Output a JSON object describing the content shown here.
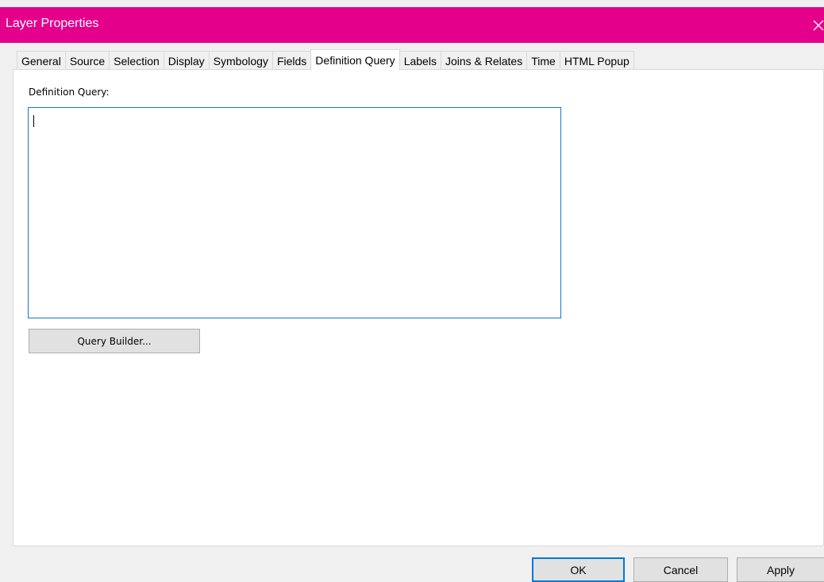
{
  "window": {
    "title": "Layer Properties",
    "accent_color": "#e5008c",
    "close_icon": "close-icon"
  },
  "tabs": [
    {
      "label": "General",
      "active": false
    },
    {
      "label": "Source",
      "active": false
    },
    {
      "label": "Selection",
      "active": false
    },
    {
      "label": "Display",
      "active": false
    },
    {
      "label": "Symbology",
      "active": false
    },
    {
      "label": "Fields",
      "active": false
    },
    {
      "label": "Definition Query",
      "active": true
    },
    {
      "label": "Labels",
      "active": false
    },
    {
      "label": "Joins & Relates",
      "active": false
    },
    {
      "label": "Time",
      "active": false
    },
    {
      "label": "HTML Popup",
      "active": false
    }
  ],
  "definition_query": {
    "label": "Definition Query:",
    "value": "",
    "query_builder_label": "Query Builder..."
  },
  "footer": {
    "ok_label": "OK",
    "cancel_label": "Cancel",
    "apply_label": "Apply"
  }
}
